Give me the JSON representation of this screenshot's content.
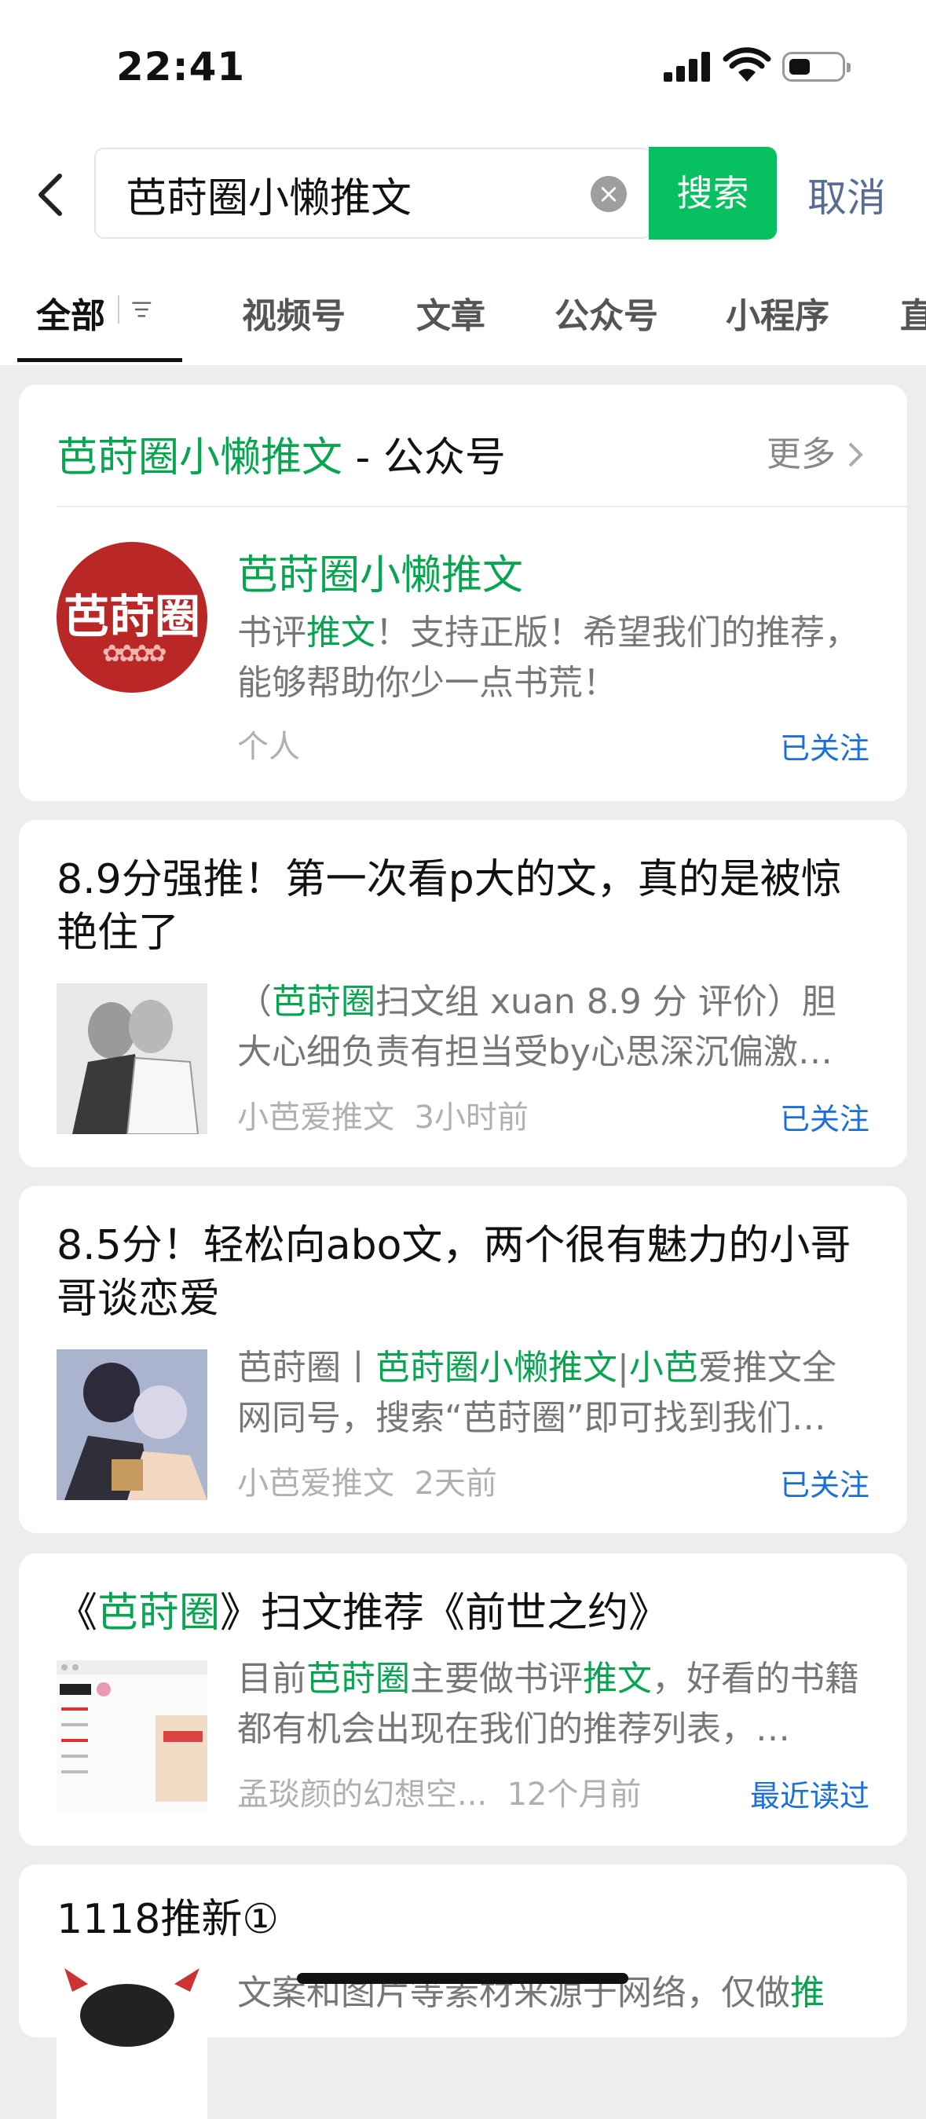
{
  "status": {
    "time": "22:41"
  },
  "search": {
    "query": "芭莳圈小懒推文",
    "button": "搜索",
    "cancel": "取消"
  },
  "tabs": [
    "全部",
    "视频号",
    "文章",
    "公众号",
    "小程序",
    "直"
  ],
  "account": {
    "section_name": "芭莳圈小懒推文",
    "section_suffix": " - 公众号",
    "more": "更多",
    "logo_text": "芭莳圈",
    "name": "芭莳圈小懒推文",
    "desc_a": "书评",
    "desc_b": "推文",
    "desc_c": "！支持正版！希望我们的推荐，能够帮助你少一点书荒！",
    "type": "个人",
    "status": "已关注"
  },
  "articles": [
    {
      "title": "8.9分强推！第一次看p大的文，真的是被惊艳住了",
      "d1": "（",
      "d2": "芭莳圈",
      "d3": "扫文组 xuan 8.9 分 评价）胆大心细负责有担当受by心思深沉偏激…",
      "source": "小芭爱推文",
      "time": "3小时前",
      "status": "已关注"
    },
    {
      "title": "8.5分！轻松向abo文，两个很有魅力的小哥哥谈恋爱",
      "d1": "芭莳圈丨",
      "d2": "芭莳圈小懒推文",
      "d3": "|",
      "d4": "小芭",
      "d5": "爱推文全网同号，搜索“芭莳圈”即可找到我们…",
      "source": "小芭爱推文",
      "time": "2天前",
      "status": "已关注"
    },
    {
      "t1": "《",
      "t2": "芭莳圈",
      "t3": "》扫文推荐《前世之约》",
      "d1": "目前",
      "d2": "芭莳圈",
      "d3": "主要做书评",
      "d4": "推文",
      "d5": "，好看的书籍都有机会出现在我们的推荐列表，…",
      "source": "孟琰颜的幻想空...",
      "time": "12个月前",
      "status": "最近读过"
    },
    {
      "title": "1118推新①",
      "d1": "文案和图片等素材来源于网络，仅做",
      "d2": "推"
    }
  ],
  "colors": {
    "accent": "#07c160",
    "highlight": "#07a550",
    "link": "#1a6fd8",
    "nav_blue": "#576b95"
  }
}
